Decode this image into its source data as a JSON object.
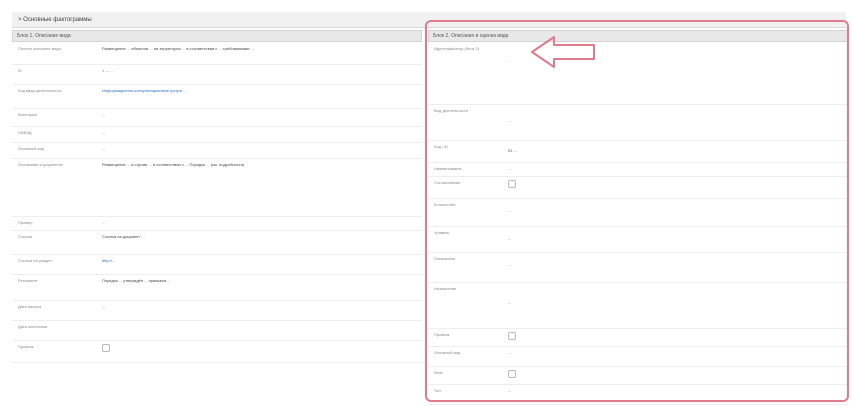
{
  "section": {
    "title": "> Основные фактограммы"
  },
  "left": {
    "header": "Блок 1. Описание вида",
    "rows": [
      {
        "label": "Полное описание вида",
        "value": "Размещение ... объектов ... на территории ... в соответствии с ... требованиями ..."
      },
      {
        "label": "ID",
        "value": "1  —  ...",
        "link": false
      },
      {
        "label": "Код вида деятельности",
        "value": "Информационно-консультационные услуги ..."
      },
      {
        "label": "Категория",
        "value": "..."
      },
      {
        "label": "ОКВЭД",
        "value": "..."
      },
      {
        "label": "Основной вид",
        "value": "..."
      },
      {
        "label": "Основания и документы",
        "value": "Размещение ... в случае ... в соответствии с ... Порядок ... (см. подробности)"
      },
      {
        "label": "Пример",
        "value": "..."
      },
      {
        "label": "Ссылки",
        "value": "Ссылка на документ ..."
      },
      {
        "label": "Ссылка на раздел",
        "value": "http://..."
      },
      {
        "label": "Регламент",
        "value": "Порядок ... утверждён ... приказом ..."
      },
      {
        "label": "Дата начала",
        "value": "..."
      },
      {
        "label": "Дата окончания",
        "value": ""
      },
      {
        "label": "Признак",
        "value": ""
      }
    ]
  },
  "right": {
    "header": "Блок 2. Описание и оценка вида",
    "rows": [
      {
        "label": "Идентификатор (блок 2)",
        "value": "..."
      },
      {
        "label": "Вид деятельности",
        "value": "..."
      },
      {
        "label": "Код / ID",
        "value": "01 ..."
      },
      {
        "label": "Наименование",
        "value": "..."
      },
      {
        "label": "Согласование",
        "value": ""
      },
      {
        "label": "Количество",
        "value": "..."
      },
      {
        "label": "Уровень",
        "value": "..."
      },
      {
        "label": "Показатель",
        "value": "..."
      },
      {
        "label": "Назначение",
        "value": "..."
      },
      {
        "label": "Признак",
        "value": ""
      },
      {
        "label": "Основной вид",
        "value": "..."
      },
      {
        "label": "Флаг",
        "value": ""
      },
      {
        "label": "Тип",
        "value": "..."
      }
    ]
  },
  "colors": {
    "highlight": "#e07b8d",
    "link": "#2a6ebd"
  }
}
